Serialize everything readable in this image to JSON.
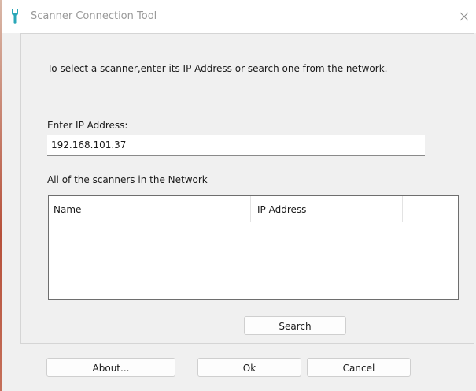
{
  "window": {
    "title": "Scanner Connection Tool",
    "close_glyph": "×",
    "app_icon": "wrench-icon"
  },
  "main": {
    "instruction": "To select a scanner,enter its IP Address or search one from the network.",
    "ip_label": "Enter IP Address:",
    "ip_value": "192.168.101.37",
    "list_label": "All of the scanners in the Network",
    "columns": [
      "Name",
      "IP Address",
      ""
    ],
    "rows": []
  },
  "buttons": {
    "search": "Search",
    "about": "About...",
    "ok": "Ok",
    "cancel": "Cancel"
  },
  "colors": {
    "title_text": "#9a9a9a",
    "background": "#f0f0f0",
    "accent_icon": "#2aa7b8"
  }
}
